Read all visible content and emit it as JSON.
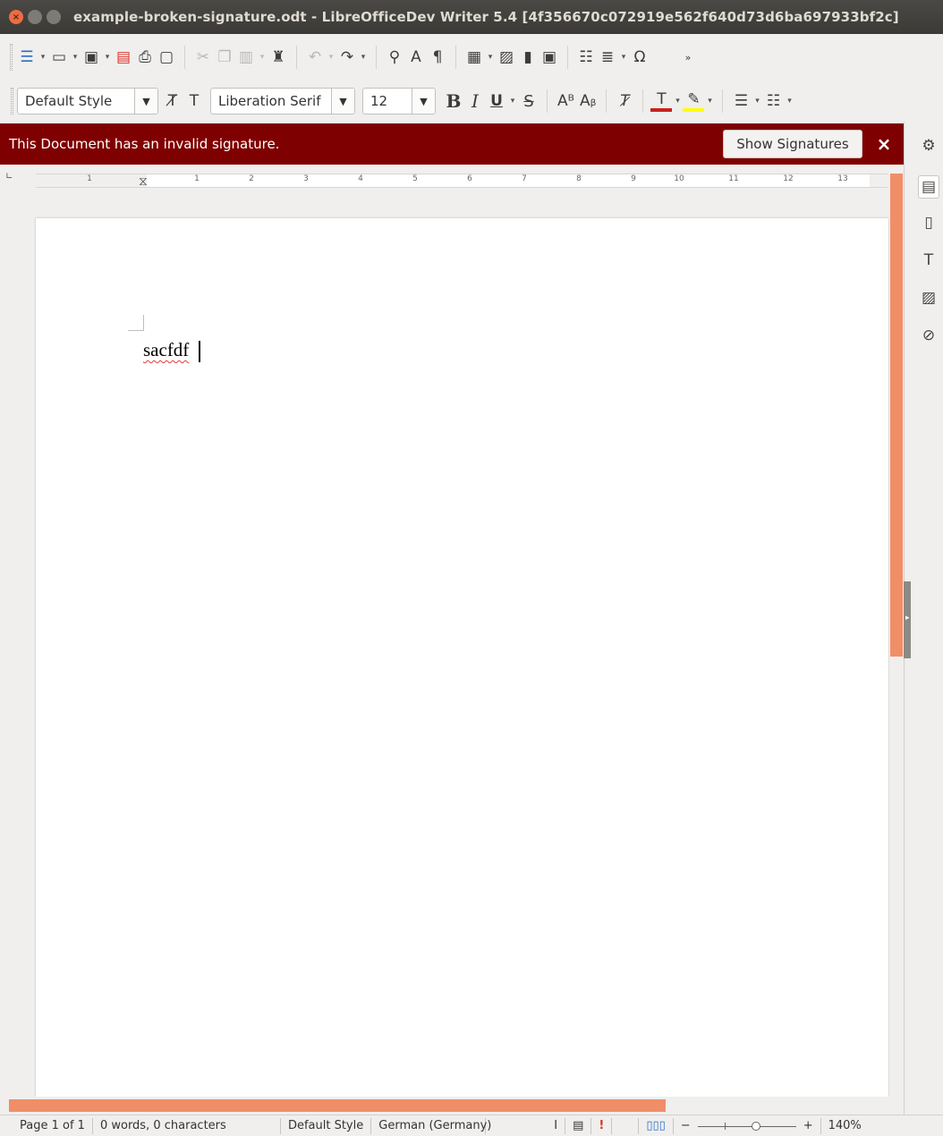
{
  "window": {
    "title": "example-broken-signature.odt - LibreOfficeDev Writer 5.4 [4f356670c072919e562f640d73d6ba697933bf2c]"
  },
  "toolbar2": {
    "paragraph_style": "Default Style",
    "font_name": "Liberation Serif",
    "font_size": "12",
    "bold": "B",
    "italic": "I",
    "underline": "U",
    "strikethrough": "S"
  },
  "infobar": {
    "message": "This Document has an invalid signature.",
    "show_signatures": "Show Signatures",
    "close": "×",
    "background_color": "#7e0000"
  },
  "ruler": {
    "numbers": [
      "1",
      "1",
      "2",
      "3",
      "4",
      "5",
      "6",
      "7",
      "8",
      "9",
      "10",
      "11",
      "12",
      "13"
    ]
  },
  "document": {
    "text": "sacfdf"
  },
  "statusbar": {
    "page": "Page 1 of 1",
    "word_count": "0 words, 0 characters",
    "page_style": "Default Style",
    "language": "German (Germany)",
    "zoom_minus": "−",
    "zoom_plus": "+",
    "zoom": "140%"
  },
  "colors": {
    "accent_scrollbar": "#f08e67",
    "close_button": "#ef6b43"
  }
}
